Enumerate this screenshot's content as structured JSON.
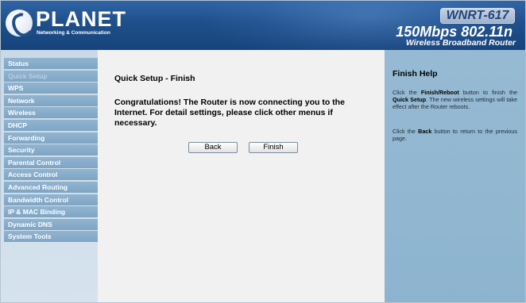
{
  "header": {
    "brand": "PLANET",
    "tagline": "Networking & Communication",
    "model": "WNRT-617",
    "speed": "150Mbps 802.11n",
    "product": "Wireless Broadband Router"
  },
  "sidebar": {
    "items": [
      {
        "label": "Status",
        "active": false
      },
      {
        "label": "Quick Setup",
        "active": true
      },
      {
        "label": "WPS",
        "active": false
      },
      {
        "label": "Network",
        "active": false
      },
      {
        "label": "Wireless",
        "active": false
      },
      {
        "label": "DHCP",
        "active": false
      },
      {
        "label": "Forwarding",
        "active": false
      },
      {
        "label": "Security",
        "active": false
      },
      {
        "label": "Parental Control",
        "active": false
      },
      {
        "label": "Access Control",
        "active": false
      },
      {
        "label": "Advanced Routing",
        "active": false
      },
      {
        "label": "Bandwidth Control",
        "active": false
      },
      {
        "label": "IP & MAC Binding",
        "active": false
      },
      {
        "label": "Dynamic DNS",
        "active": false
      },
      {
        "label": "System Tools",
        "active": false
      }
    ]
  },
  "main": {
    "title": "Quick Setup - Finish",
    "message": "Congratulations! The Router is now connecting you to the Internet. For detail settings, please click other menus if necessary.",
    "back_label": "Back",
    "finish_label": "Finish"
  },
  "help": {
    "title": "Finish Help",
    "p1_a": "Click the ",
    "p1_b": "Finish/Reboot",
    "p1_c": " button to finish the ",
    "p1_d": "Quick Setup",
    "p1_e": ". The new wireless settings will take effect after the Router reboots.",
    "p2_a": "Click the ",
    "p2_b": "Back",
    "p2_c": " button to return to the previous page."
  },
  "colors": {
    "header_blue": "#1f4f8a",
    "sidebar_bg": "#c9d9e7",
    "menu_item_bg": "#86aac8",
    "help_bg": "#92b7d1",
    "main_bg": "#f1f1f1"
  },
  "icons": {
    "logo": "planet-logo-icon"
  }
}
